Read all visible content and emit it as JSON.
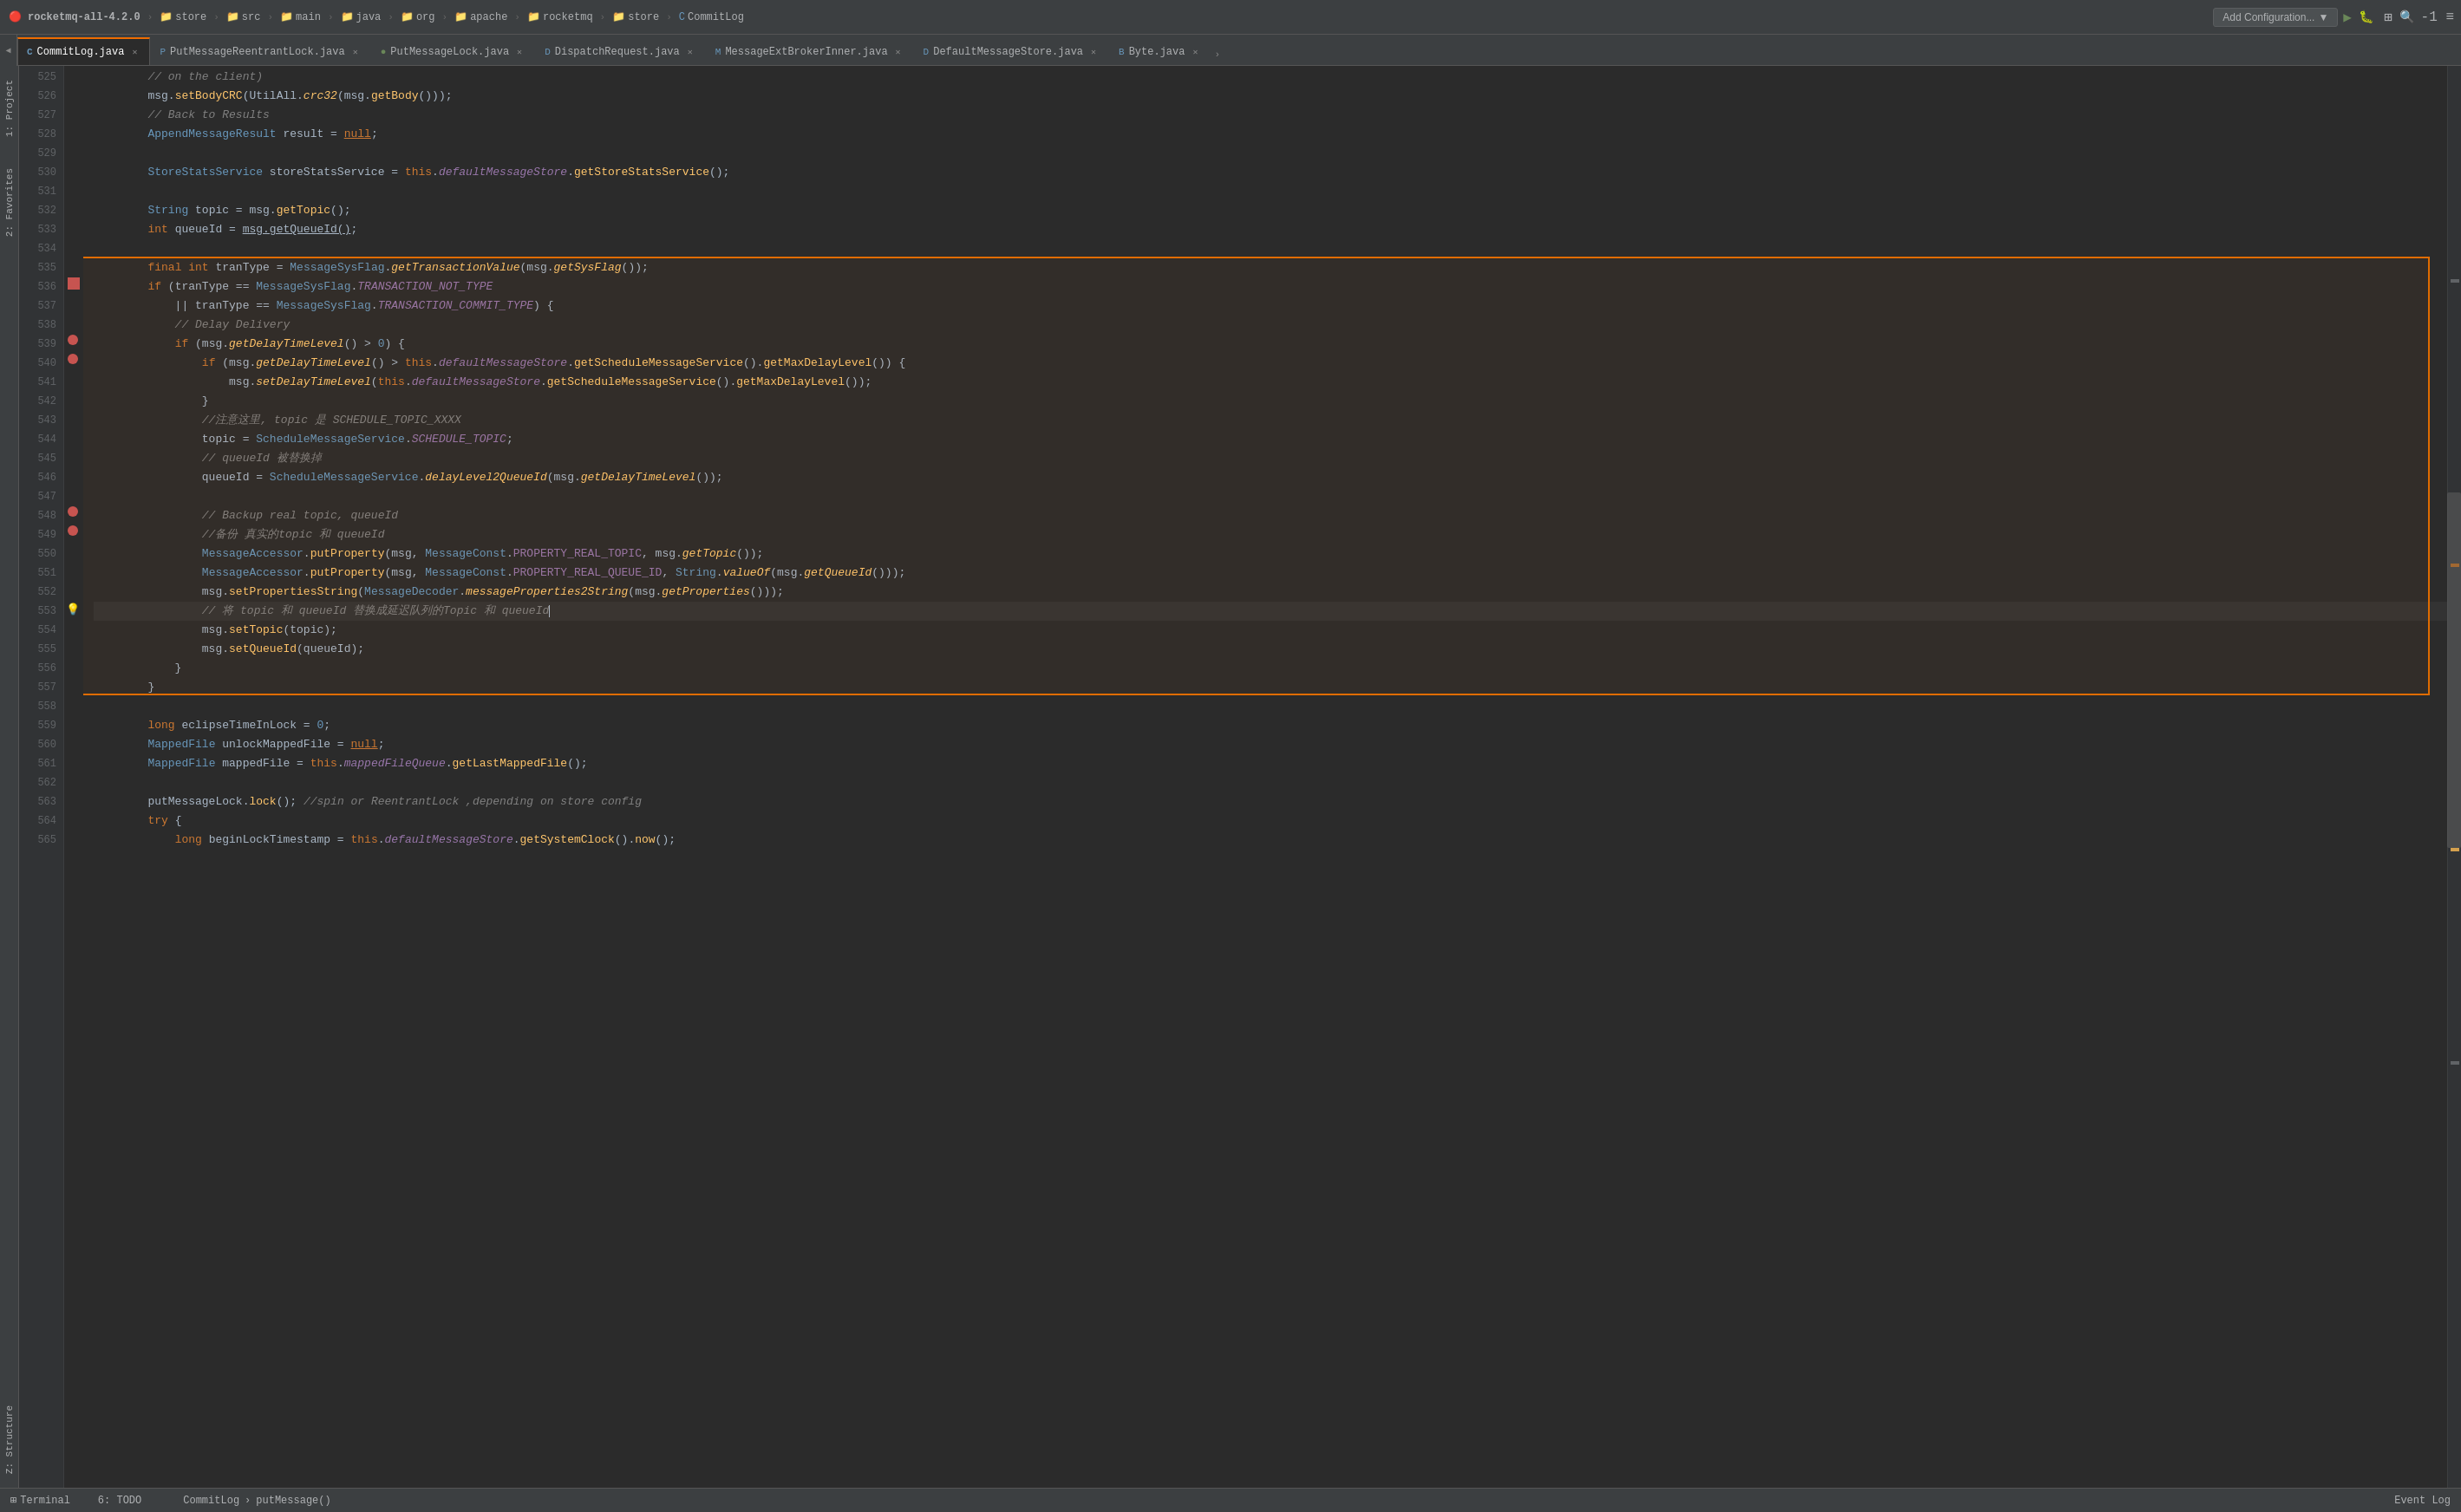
{
  "toolbar": {
    "project": "rocketmq-all-4.2.0",
    "breadcrumbs": [
      {
        "label": "store",
        "type": "folder"
      },
      {
        "label": "src",
        "type": "folder"
      },
      {
        "label": "main",
        "type": "folder"
      },
      {
        "label": "java",
        "type": "folder"
      },
      {
        "label": "org",
        "type": "folder"
      },
      {
        "label": "apache",
        "type": "folder"
      },
      {
        "label": "rocketmq",
        "type": "folder"
      },
      {
        "label": "store",
        "type": "folder"
      },
      {
        "label": "CommitLog",
        "type": "class"
      }
    ],
    "add_config_label": "Add Configuration...",
    "run_icon": "▶",
    "debug_icon": "🐛"
  },
  "tabs": [
    {
      "label": "CommitLog.java",
      "active": true,
      "type": "java",
      "modified": false
    },
    {
      "label": "PutMessageReentrantLock.java",
      "active": false,
      "type": "java"
    },
    {
      "label": "PutMessageLock.java",
      "active": false,
      "type": "java"
    },
    {
      "label": "DispatchRequest.java",
      "active": false,
      "type": "java"
    },
    {
      "label": "MessageExtBrokerInner.java",
      "active": false,
      "type": "java"
    },
    {
      "label": "DefaultMessageStore.java",
      "active": false,
      "type": "java"
    },
    {
      "label": "Byte.java",
      "active": false,
      "type": "java"
    }
  ],
  "lines": [
    {
      "num": 525,
      "code": "        // on the client)"
    },
    {
      "num": 526,
      "code": "        msg.setBodyCRC(UtilAll.crc32(msg.getBody()));"
    },
    {
      "num": 527,
      "code": "        // Back to Results"
    },
    {
      "num": 528,
      "code": "        AppendMessageResult result = null;"
    },
    {
      "num": 529,
      "code": ""
    },
    {
      "num": 530,
      "code": "        StoreStatsService storeStatsService = this.defaultMessageStore.getStoreStatsService();"
    },
    {
      "num": 531,
      "code": ""
    },
    {
      "num": 532,
      "code": "        String topic = msg.getTopic();"
    },
    {
      "num": 533,
      "code": "        int queueId = msg.getQueueId();"
    },
    {
      "num": 534,
      "code": ""
    },
    {
      "num": 535,
      "code": "        final int tranType = MessageSysFlag.getTransactionValue(msg.getSysFlag());"
    },
    {
      "num": 536,
      "code": "        if (tranType == MessageSysFlag.TRANSACTION_NOT_TYPE"
    },
    {
      "num": 537,
      "code": "            || tranType == MessageSysFlag.TRANSACTION_COMMIT_TYPE) {"
    },
    {
      "num": 538,
      "code": "            // Delay Delivery"
    },
    {
      "num": 539,
      "code": "            if (msg.getDelayTimeLevel() > 0) {"
    },
    {
      "num": 540,
      "code": "                if (msg.getDelayTimeLevel() > this.defaultMessageStore.getScheduleMessageService().getMaxDelayLevel()) {"
    },
    {
      "num": 541,
      "code": "                    msg.setDelayTimeLevel(this.defaultMessageStore.getScheduleMessageService().getMaxDelayLevel());"
    },
    {
      "num": 542,
      "code": "                }"
    },
    {
      "num": 543,
      "code": "                //注意这里, topic 是 SCHEDULE_TOPIC_XXXX"
    },
    {
      "num": 544,
      "code": "                topic = ScheduleMessageService.SCHEDULE_TOPIC;"
    },
    {
      "num": 545,
      "code": "                // queueId 被替换掉"
    },
    {
      "num": 546,
      "code": "                queueId = ScheduleMessageService.delayLevel2QueueId(msg.getDelayTimeLevel());"
    },
    {
      "num": 547,
      "code": ""
    },
    {
      "num": 548,
      "code": "                // Backup real topic, queueId"
    },
    {
      "num": 549,
      "code": "                //备份 真实的topic 和 queueId"
    },
    {
      "num": 550,
      "code": "                MessageAccessor.putProperty(msg, MessageConst.PROPERTY_REAL_TOPIC, msg.getTopic());"
    },
    {
      "num": 551,
      "code": "                MessageAccessor.putProperty(msg, MessageConst.PROPERTY_REAL_QUEUE_ID, String.valueOf(msg.getQueueId()));"
    },
    {
      "num": 552,
      "code": "                msg.setPropertiesString(MessageDecoder.messageProperties2String(msg.getProperties()));"
    },
    {
      "num": 553,
      "code": "                // 将 topic 和 queueId 替换成延迟队列的Topic 和 queueId"
    },
    {
      "num": 554,
      "code": "                msg.setTopic(topic);"
    },
    {
      "num": 555,
      "code": "                msg.setQueueId(queueId);"
    },
    {
      "num": 556,
      "code": "            }"
    },
    {
      "num": 557,
      "code": "        }"
    },
    {
      "num": 558,
      "code": ""
    },
    {
      "num": 559,
      "code": "        long eclipseTimeInLock = 0;"
    },
    {
      "num": 560,
      "code": "        MappedFile unlockMappedFile = null;"
    },
    {
      "num": 561,
      "code": "        MappedFile mappedFile = this.mappedFileQueue.getLastMappedFile();"
    },
    {
      "num": 562,
      "code": ""
    },
    {
      "num": 563,
      "code": "        putMessageLock.lock(); //spin or ReentrantLock ,depending on store config"
    },
    {
      "num": 564,
      "code": "        try {"
    },
    {
      "num": 565,
      "code": "            long beginLockTimestamp = this.defaultMessageStore.getSystemClock().now();"
    }
  ],
  "bottom_bar": {
    "left_label": "CommitLog",
    "method_label": "putMessage()",
    "right_label": "Event Log"
  },
  "left_panels": [
    {
      "label": "1: Project"
    },
    {
      "label": "2: Favorites"
    },
    {
      "label": "Z: Structure"
    }
  ],
  "status_bar": {
    "terminal": "Terminal",
    "todo": "6: TODO",
    "event_log": "Event Log"
  }
}
